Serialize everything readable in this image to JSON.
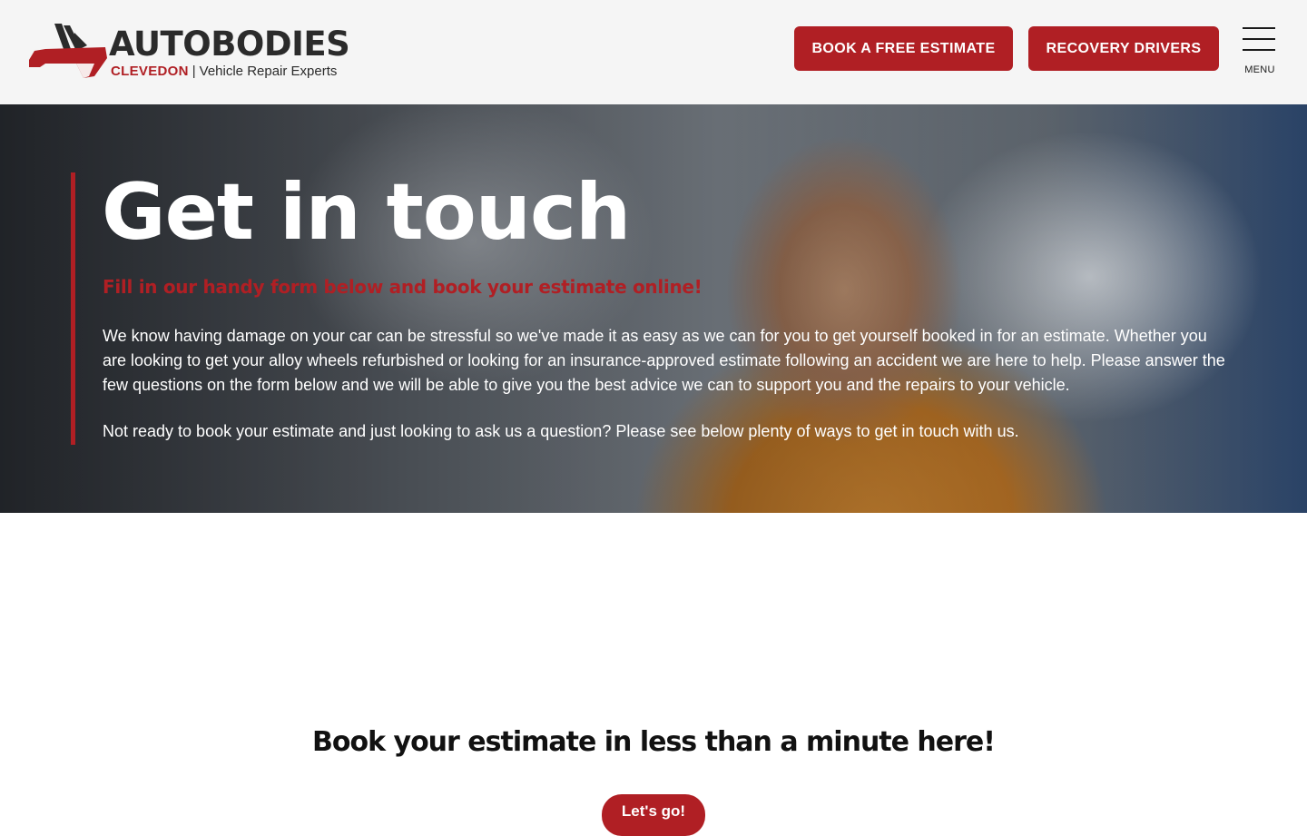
{
  "header": {
    "logo": {
      "title": "AUTOBODIES",
      "location": "CLEVEDON",
      "separator": "|",
      "tagline": "Vehicle Repair Experts"
    },
    "buttons": {
      "estimate_label": "BOOK A FREE ESTIMATE",
      "recovery_label": "RECOVERY DRIVERS"
    },
    "menu": {
      "label": "MENU",
      "icon": "hamburger-icon"
    }
  },
  "hero": {
    "title": "Get in touch",
    "subtitle": "Fill in our handy form below and book your estimate online!",
    "paragraph_1": "We know having damage on your car can be stressful so we've made it as easy as we can for you to get yourself booked in for an estimate. Whether you are looking to get your alloy wheels refurbished or looking for an insurance-approved estimate following an accident we are here to help. Please answer the few questions on the form below and we will be able to give you the best advice we can to support you and the repairs to your vehicle.",
    "paragraph_2": "Not ready to book your estimate and just looking to ask us a question? Please see below plenty of ways to get in touch with us."
  },
  "booking": {
    "heading": "Book your estimate in less than a minute here!",
    "button_label": "Let's go!"
  },
  "colors": {
    "brand_red": "#b01f24",
    "dark_text": "#2b2b2b",
    "header_bg": "#f5f5f5"
  }
}
